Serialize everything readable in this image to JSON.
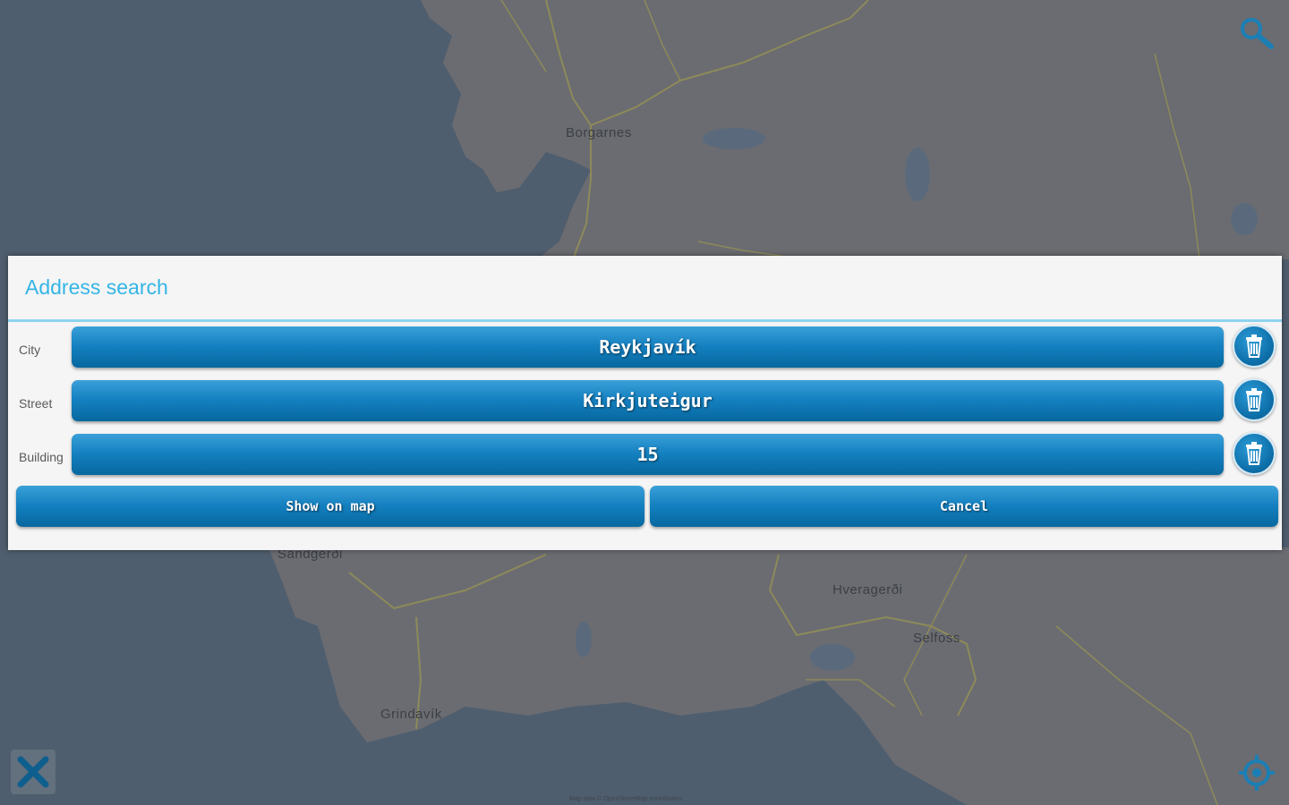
{
  "map": {
    "places": [
      "Borgarnes",
      "Sandgerði",
      "Hveragerði",
      "Selfoss",
      "Grindavík"
    ],
    "attribution": "Map data © OpenStreetMap contributors",
    "colors": {
      "sea": "#4f5e6e",
      "land": "#6b6c71",
      "road": "#8d8a5a"
    }
  },
  "toolbar": {
    "search_icon": "magnifier-icon",
    "close_icon": "close-x-icon",
    "locate_icon": "gps-target-icon"
  },
  "dialog": {
    "title": "Address search",
    "fields": [
      {
        "label": "City",
        "value": "Reykjavík"
      },
      {
        "label": "Street",
        "value": "Kirkjuteigur"
      },
      {
        "label": "Building",
        "value": "15"
      }
    ],
    "clear_icon": "trash-icon",
    "show_on_map_label": "Show on map",
    "cancel_label": "Cancel",
    "colors": {
      "accent": "#33b5e5",
      "button": "#1480c0",
      "background": "#f5f5f5"
    }
  }
}
